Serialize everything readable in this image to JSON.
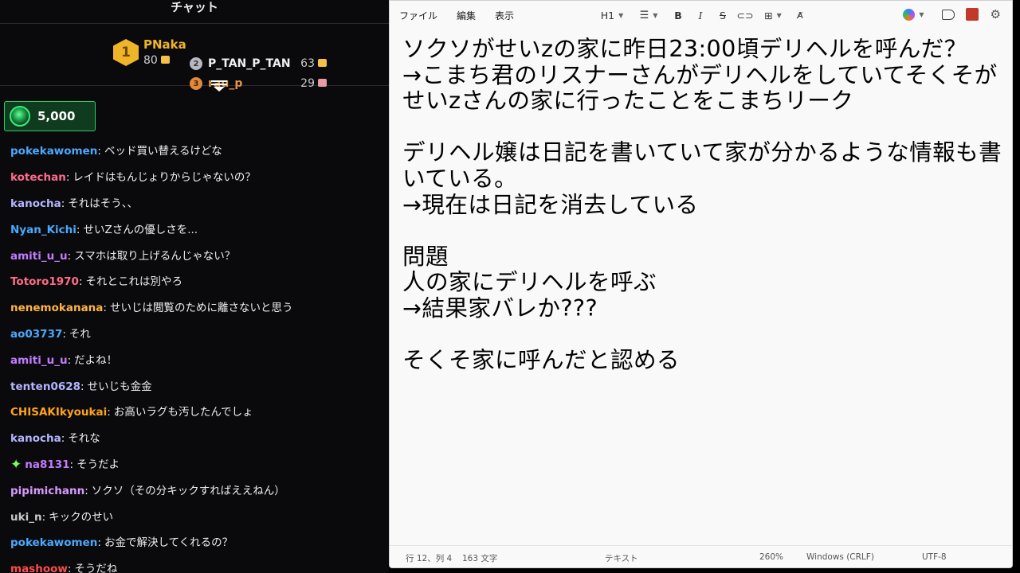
{
  "chat": {
    "title": "チャット",
    "leaderboard": {
      "first": {
        "rank": "1",
        "name": "PNaka",
        "score": "80"
      },
      "second": {
        "rank": "2",
        "name": "P_TAN_P_TAN",
        "score": "63"
      },
      "third": {
        "rank": "3",
        "name": "rau_p",
        "score": "29"
      }
    },
    "pinned_gift": {
      "amount": "5,000"
    },
    "messages": [
      {
        "user": "pokekawomen",
        "text": "ベッド買い替えるけどな",
        "color": "#4aa8ff"
      },
      {
        "user": "kotechan",
        "text": "レイドはもんじょりからじゃないの？",
        "color": "#ff6b8b"
      },
      {
        "user": "kanocha",
        "text": "それはそう、、",
        "color": "#b4b4ff"
      },
      {
        "user": "Nyan_Kichi",
        "text": "せいZさんの優しさを...",
        "color": "#4aa8ff"
      },
      {
        "user": "amiti_u_u",
        "text": "スマホは取り上げるんじゃない？",
        "color": "#c27bff"
      },
      {
        "user": "Totoro1970",
        "text": "それとこれは別やろ",
        "color": "#ff6b8b"
      },
      {
        "user": "nenemokanana",
        "text": "せいじは閲覧のために離さないと思う",
        "color": "#ffb347"
      },
      {
        "user": "ao03737",
        "text": "それ",
        "color": "#4aa8ff"
      },
      {
        "user": "amiti_u_u",
        "text": "だよね！",
        "color": "#c27bff"
      },
      {
        "user": "tenten0628",
        "text": "せいじも金金",
        "color": "#b4b4ff"
      },
      {
        "user": "CHISAKIkyoukai",
        "text": "お高いラグも汚したんでしょ",
        "color": "#ffa31a"
      },
      {
        "user": "kanocha",
        "text": "それな",
        "color": "#b4b4ff"
      },
      {
        "user": "na8131",
        "text": "そうだよ",
        "color": "#c27bff"
      },
      {
        "user": "pipimichann",
        "text": "ソクソ（その分キックすればええねん）",
        "color": "#d79bff"
      },
      {
        "user": "uki_n",
        "text": "キックのせい",
        "color": "#c8c8c8"
      },
      {
        "user": "pokekawomen",
        "text": "お金で解決してくれるの？",
        "color": "#4aa8ff"
      },
      {
        "user": "mashoow",
        "text": "そうだね",
        "color": "#ff4d4d"
      }
    ]
  },
  "notepad": {
    "menu": [
      "ファイル",
      "編集",
      "表示"
    ],
    "toolbar": {
      "heading": "H1",
      "bold": "B",
      "italic": "I",
      "strike": "S"
    },
    "content": "ソクソがせいzの家に昨日23:00頃デリヘルを呼んだ？\n→こまち君のリスナーさんがデリヘルをしていてそくそがせいzさんの家に行ったことをこまちリーク\n\nデリヘル嬢は日記を書いていて家が分かるような情報も書いている。\n→現在は日記を消去している\n\n問題\n人の家にデリヘルを呼ぶ\n→結果家バレか???\n\nそくそ家に呼んだと認める",
    "status": {
      "position": "行 12、列 4",
      "chars": "163 文字",
      "mode": "テキスト",
      "zoom": "260%",
      "eol": "Windows (CRLF)",
      "encoding": "UTF-8"
    }
  }
}
